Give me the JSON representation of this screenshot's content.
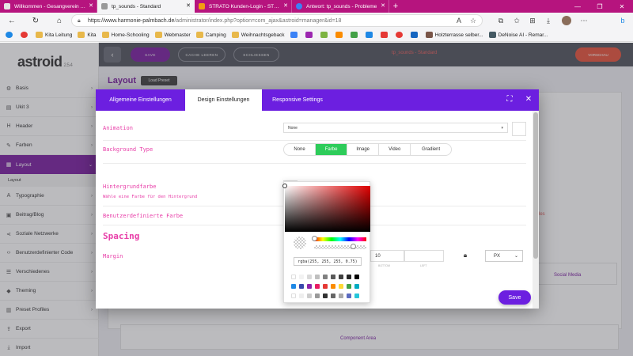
{
  "browser": {
    "tabs": [
      {
        "title": "Willkommen - Gesangverein Ha",
        "active": false
      },
      {
        "title": "tp_sounds - Standard",
        "active": true
      },
      {
        "title": "STRATO Kunden-Login - STRATO",
        "active": false
      },
      {
        "title": "Antwort: tp_sounds - Probleme",
        "active": false
      }
    ],
    "new_tab": "+",
    "window_controls": [
      "—",
      "❐",
      "✕"
    ],
    "url_host": "https://www.harmonie-palmbach.de",
    "url_path": "/administrator/index.php?option=com_ajax&astroid=manager&id=18",
    "bookmarks": [
      {
        "label": "Kita Leitung",
        "icon": "folder"
      },
      {
        "label": "Kita",
        "icon": "folder"
      },
      {
        "label": "Home-Schooling",
        "icon": "folder"
      },
      {
        "label": "Webmaster",
        "icon": "folder"
      },
      {
        "label": "Camping",
        "icon": "folder"
      },
      {
        "label": "Weihnachtsgeback",
        "icon": "folder"
      },
      {
        "label": "Holzterrasse selber...",
        "icon": "bookmark"
      },
      {
        "label": "DeNoise AI - Remar...",
        "icon": "bookmark"
      }
    ]
  },
  "app": {
    "logo": "astroid",
    "version": "2.5.4",
    "sidebar": [
      {
        "label": "Basis",
        "icon": "settings-icon"
      },
      {
        "label": "Ukit 3",
        "icon": "layers-icon"
      },
      {
        "label": "Header",
        "icon": "header-icon"
      },
      {
        "label": "Farben",
        "icon": "brush-icon"
      },
      {
        "label": "Layout",
        "icon": "layout-icon",
        "active": true
      },
      {
        "label": "Typographie",
        "icon": "typography-icon"
      },
      {
        "label": "Beitrag/Blog",
        "icon": "blog-icon"
      },
      {
        "label": "Soziale Netzwerke",
        "icon": "share-icon"
      },
      {
        "label": "Benutzerdefinierter Code",
        "icon": "code-icon"
      },
      {
        "label": "Verschiedenes",
        "icon": "misc-icon"
      },
      {
        "label": "Theming",
        "icon": "theming-icon"
      },
      {
        "label": "Preset Profiles",
        "icon": "presets-icon"
      },
      {
        "label": "Export",
        "icon": "export-icon"
      },
      {
        "label": "Import",
        "icon": "import-icon"
      }
    ],
    "sidebar_sub": "Layout",
    "topbar": {
      "save": "SAVE",
      "cache": "CACHE LEEREN",
      "close": "SCHLIESSEN",
      "title": "tp_sounds - Standard",
      "preview": "VORSCHAU"
    },
    "page_title": "Layout",
    "load_preset": "Load Preset",
    "background": {
      "social": "Social Media",
      "component": "Component Area",
      "styles": "les"
    }
  },
  "modal": {
    "tabs": [
      "Allgemeine Einstellungen",
      "Design Einstellungen",
      "Responsive Settings"
    ],
    "active_tab": 1,
    "fields": {
      "animation_label": "Animation",
      "animation_value": "None",
      "background_type_label": "Background Type",
      "background_types": [
        "None",
        "Farbe",
        "Image",
        "Video",
        "Gradient"
      ],
      "background_type_selected": "Farbe",
      "hintergrund_label": "Hintergrundfarbe",
      "hintergrund_desc": "Wähle eine Farbe für den Hintergrund",
      "benutzerdefinierte_label": "Benutzerdefinierte Farbe",
      "spacing_label": "Spacing",
      "margin_label": "Margin",
      "margin_values": [
        "",
        "10",
        ""
      ],
      "margin_field_labels": [
        "BOTTOM",
        "LEFT"
      ],
      "unit": "PX"
    },
    "save_button": "Save"
  },
  "color_picker": {
    "value": "rgba(255, 255, 255, 0.75)",
    "base_hue_color": "#e00000",
    "swatch_rows": [
      [
        "#ffffff",
        "#f2f2f2",
        "#d9d9d9",
        "#bfbfbf",
        "#808080",
        "#595959",
        "#404040",
        "#262626",
        "#000000"
      ],
      [
        "#1e88e5",
        "#3949ab",
        "#8e24aa",
        "#e91e63",
        "#e53935",
        "#fb8c00",
        "#fdd835",
        "#43a047",
        "#00acc1"
      ],
      [
        "#ffffff",
        "#eeeeee",
        "#cccccc",
        "#999999",
        "#333333",
        "#666666",
        "#aaaaaa",
        "#5c6bc0",
        "#26c6da"
      ]
    ]
  }
}
